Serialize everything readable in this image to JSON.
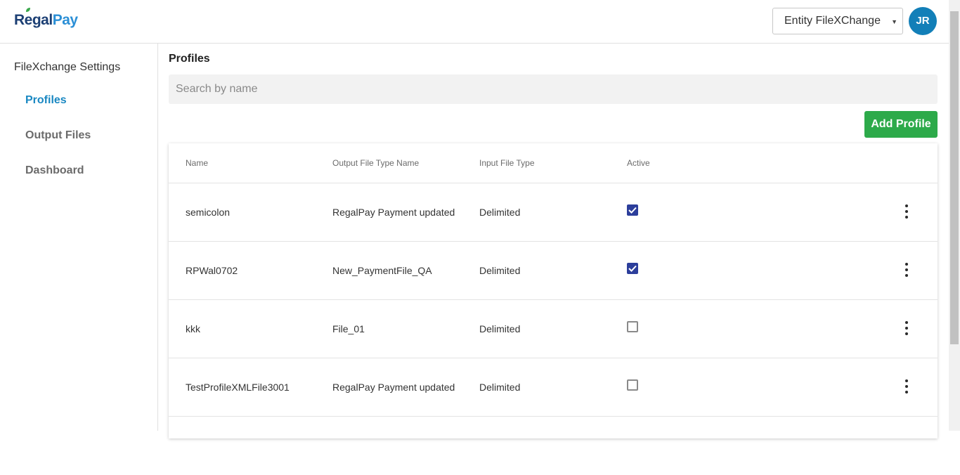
{
  "header": {
    "logo_regal": "Regal",
    "logo_pay": "Pay",
    "entity_selected": "Entity FileXChange",
    "avatar_initials": "JR"
  },
  "sidebar": {
    "heading": "FileXchange Settings",
    "items": [
      {
        "label": "Profiles",
        "active": true
      },
      {
        "label": "Output Files",
        "active": false
      },
      {
        "label": "Dashboard",
        "active": false
      }
    ]
  },
  "main": {
    "title": "Profiles",
    "search_placeholder": "Search by name",
    "add_button": "Add Profile",
    "columns": [
      "Name",
      "Output File Type Name",
      "Input File Type",
      "Active"
    ],
    "rows": [
      {
        "name": "semicolon",
        "output": "RegalPay Payment updated",
        "input": "Delimited",
        "active": true
      },
      {
        "name": "RPWal0702",
        "output": "New_PaymentFile_QA",
        "input": "Delimited",
        "active": true
      },
      {
        "name": "kkk",
        "output": "File_01",
        "input": "Delimited",
        "active": false
      },
      {
        "name": "TestProfileXMLFile3001",
        "output": "RegalPay Payment updated",
        "input": "Delimited",
        "active": false
      }
    ]
  },
  "colors": {
    "accent": "#1a88c2",
    "add_button": "#2daa4a",
    "checkbox_checked": "#2c3e9b",
    "avatar": "#127fb8"
  }
}
